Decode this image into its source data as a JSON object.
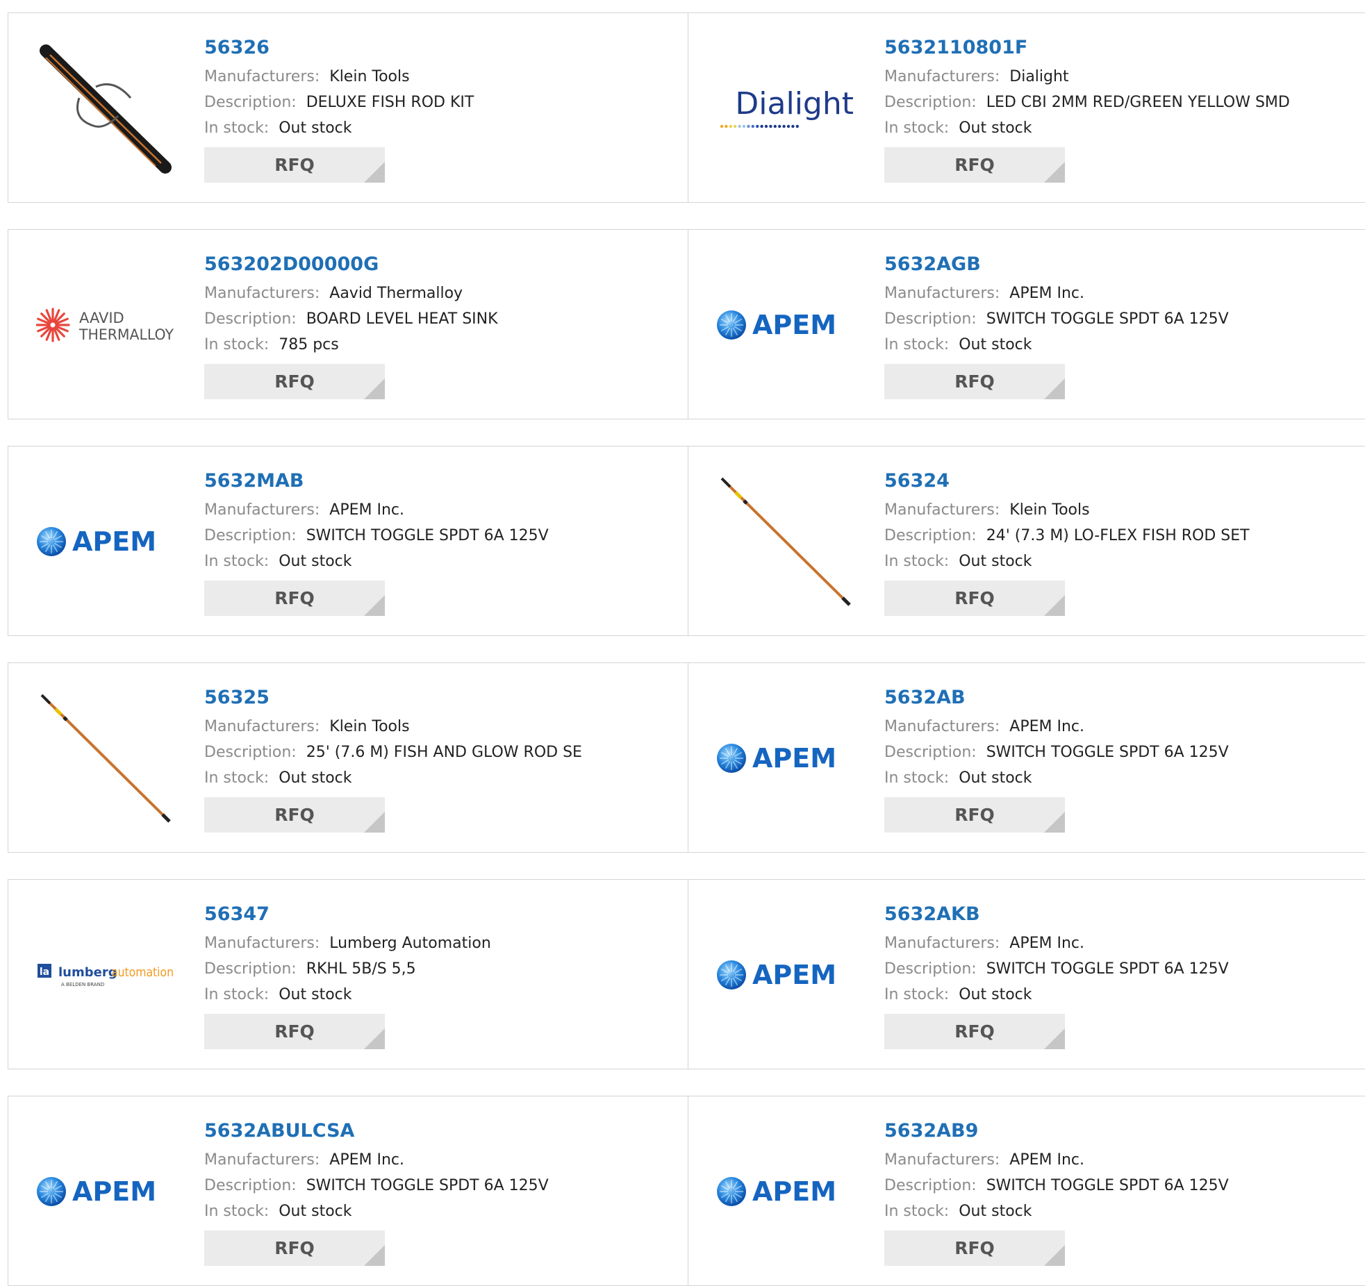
{
  "labels": {
    "manufacturer": "Manufacturers:",
    "description": "Description:",
    "stock": "In stock:"
  },
  "rfq_label": "RFQ",
  "colors": {
    "part_link": "#1f6fb5",
    "rfq_bg": "#ebebeb",
    "label_gray": "#8a8a8a",
    "apem_blue": "#1565c0",
    "aavid_red": "#e8453c",
    "rod_orange": "#c8732e"
  },
  "products": [
    {
      "part": "56326",
      "manufacturer": "Klein Tools",
      "description": "DELUXE FISH ROD KIT",
      "stock": "Out stock",
      "image": "fish-rod-kit-bag"
    },
    {
      "part": "5632110801F",
      "manufacturer": "Dialight",
      "description": "LED CBI 2MM RED/GREEN YELLOW SMD",
      "stock": "Out stock",
      "image": "dialight-logo",
      "logo_text": "Dialight"
    },
    {
      "part": "563202D00000G",
      "manufacturer": "Aavid Thermalloy",
      "description": "BOARD LEVEL HEAT SINK",
      "stock": "785 pcs",
      "image": "aavid-thermalloy-logo",
      "logo_text": [
        "AAVID",
        "THERMALLOY"
      ]
    },
    {
      "part": "5632AGB",
      "manufacturer": "APEM Inc.",
      "description": "SWITCH TOGGLE SPDT 6A 125V",
      "stock": "Out stock",
      "image": "apem-logo",
      "logo_text": "APEM"
    },
    {
      "part": "5632MAB",
      "manufacturer": "APEM Inc.",
      "description": "SWITCH TOGGLE SPDT 6A 125V",
      "stock": "Out stock",
      "image": "apem-logo",
      "logo_text": "APEM"
    },
    {
      "part": "56324",
      "manufacturer": "Klein Tools",
      "description": "24' (7.3 M) LO-FLEX FISH ROD SET",
      "stock": "Out stock",
      "image": "fish-rod"
    },
    {
      "part": "56325",
      "manufacturer": "Klein Tools",
      "description": "25' (7.6 M) FISH AND GLOW ROD SE",
      "stock": "Out stock",
      "image": "glow-rod"
    },
    {
      "part": "5632AB",
      "manufacturer": "APEM Inc.",
      "description": "SWITCH TOGGLE SPDT 6A 125V",
      "stock": "Out stock",
      "image": "apem-logo",
      "logo_text": "APEM"
    },
    {
      "part": "56347",
      "manufacturer": "Lumberg Automation",
      "description": "RKHL 5B/S 5,5",
      "stock": "Out stock",
      "image": "lumberg-logo",
      "logo_text": [
        "lumberg",
        "automation",
        "A BELDEN BRAND"
      ]
    },
    {
      "part": "5632AKB",
      "manufacturer": "APEM Inc.",
      "description": "SWITCH TOGGLE SPDT 6A 125V",
      "stock": "Out stock",
      "image": "apem-logo",
      "logo_text": "APEM"
    },
    {
      "part": "5632ABULCSA",
      "manufacturer": "APEM Inc.",
      "description": "SWITCH TOGGLE SPDT 6A 125V",
      "stock": "Out stock",
      "image": "apem-logo",
      "logo_text": "APEM"
    },
    {
      "part": "5632AB9",
      "manufacturer": "APEM Inc.",
      "description": "SWITCH TOGGLE SPDT 6A 125V",
      "stock": "Out stock",
      "image": "apem-logo",
      "logo_text": "APEM"
    }
  ]
}
